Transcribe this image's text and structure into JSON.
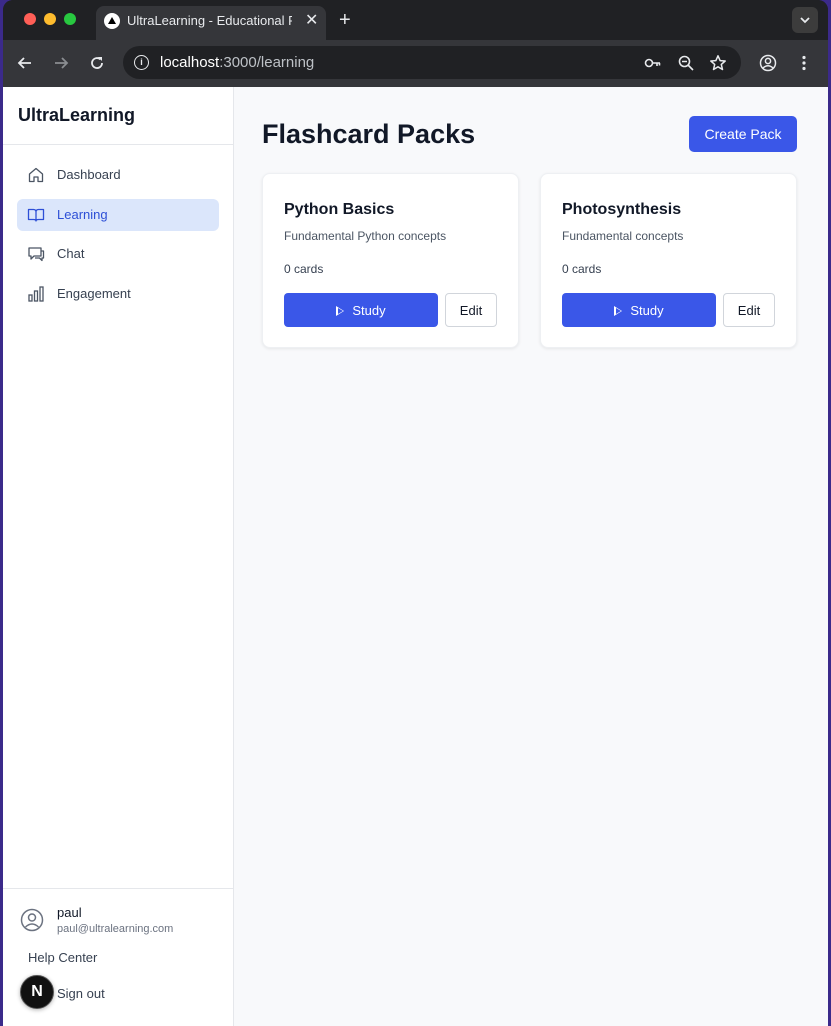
{
  "browser": {
    "tab_title": "UltraLearning - Educational Platform",
    "url_host": "localhost",
    "url_rest": ":3000/learning",
    "new_tab": "+",
    "close_tab": "✕"
  },
  "sidebar": {
    "brand": "UltraLearning",
    "items": [
      {
        "label": "Dashboard",
        "icon": "home-icon",
        "active": false
      },
      {
        "label": "Learning",
        "icon": "book-icon",
        "active": true
      },
      {
        "label": "Chat",
        "icon": "chat-icon",
        "active": false
      },
      {
        "label": "Engagement",
        "icon": "bar-chart-icon",
        "active": false
      }
    ],
    "user": {
      "name": "paul",
      "email": "paul@ultralearning.com"
    },
    "help": "Help Center",
    "signout": "Sign out",
    "next_badge": "N"
  },
  "main": {
    "title": "Flashcard Packs",
    "create_label": "Create Pack",
    "packs": [
      {
        "title": "Python Basics",
        "description": "Fundamental Python concepts",
        "count": "0 cards",
        "study": "Study",
        "edit": "Edit"
      },
      {
        "title": "Photosynthesis",
        "description": "Fundamental concepts",
        "count": "0 cards",
        "study": "Study",
        "edit": "Edit"
      }
    ]
  },
  "colors": {
    "accent": "#3a57e8",
    "active_nav_bg": "#dbe6fb"
  }
}
